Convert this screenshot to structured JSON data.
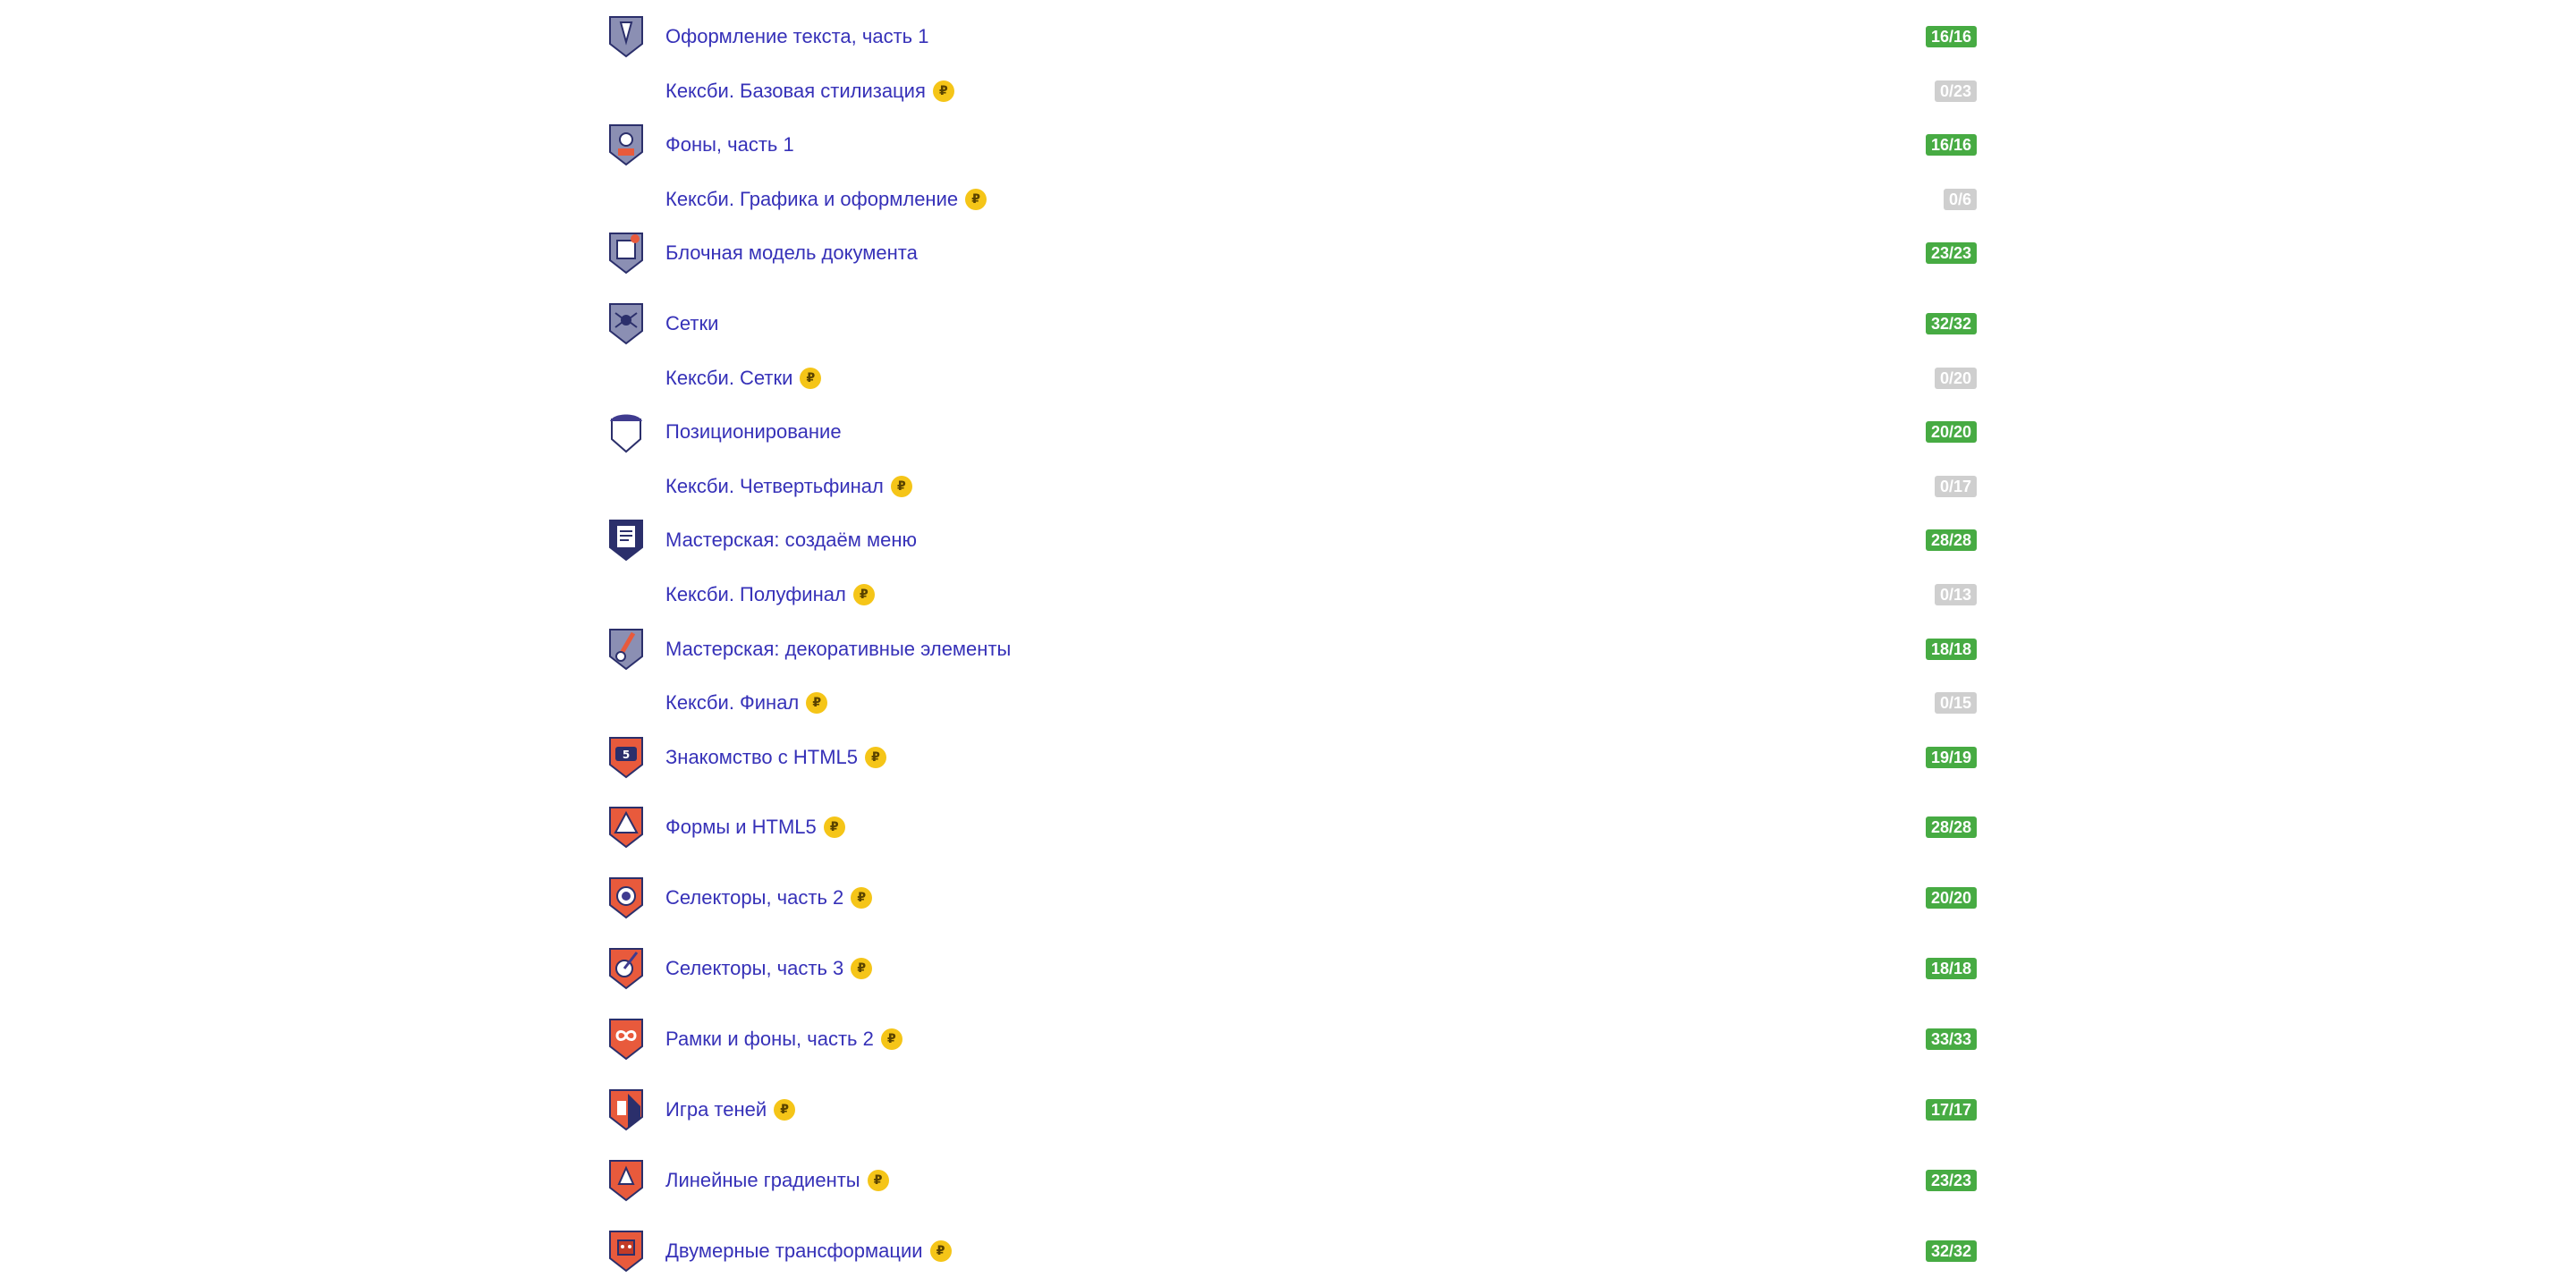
{
  "colors": {
    "link": "#3631b8",
    "done_badge": "#47ab43",
    "none_badge": "#cfcfcf",
    "coin": "#f5c518"
  },
  "courses": [
    {
      "title": "Оформление текста, часть 1",
      "progress": "16/16",
      "status": "done",
      "icon": "pen-shield-icon",
      "paid": false
    },
    {
      "title": "Кексби. Базовая стилизация",
      "progress": "0/23",
      "status": "none",
      "icon": "",
      "paid": true
    },
    {
      "title": "Фоны, часть 1",
      "progress": "16/16",
      "status": "done",
      "icon": "paint-shield-icon",
      "paid": false
    },
    {
      "title": "Кексби. Графика и оформление",
      "progress": "0/6",
      "status": "none",
      "icon": "",
      "paid": true
    },
    {
      "title": "Блочная модель документа",
      "progress": "23/23",
      "status": "done",
      "icon": "box-shield-icon",
      "paid": false
    },
    {
      "title": "Сетки",
      "progress": "32/32",
      "status": "done",
      "icon": "spider-shield-icon",
      "paid": false
    },
    {
      "title": "Кексби. Сетки",
      "progress": "0/20",
      "status": "none",
      "icon": "",
      "paid": true
    },
    {
      "title": "Позиционирование",
      "progress": "20/20",
      "status": "done",
      "icon": "hat-shield-icon",
      "paid": false
    },
    {
      "title": "Кексби. Четвертьфинал",
      "progress": "0/17",
      "status": "none",
      "icon": "",
      "paid": true
    },
    {
      "title": "Мастерская: создаём меню",
      "progress": "28/28",
      "status": "done",
      "icon": "document-shield-icon",
      "paid": false
    },
    {
      "title": "Кексби. Полуфинал",
      "progress": "0/13",
      "status": "none",
      "icon": "",
      "paid": true
    },
    {
      "title": "Мастерская: декоративные элементы",
      "progress": "18/18",
      "status": "done",
      "icon": "brush-shield-icon",
      "paid": false
    },
    {
      "title": "Кексби. Финал",
      "progress": "0/15",
      "status": "none",
      "icon": "",
      "paid": true
    },
    {
      "title": "Знакомство с HTML5",
      "progress": "19/19",
      "status": "done",
      "icon": "html5-shield-icon",
      "paid": true
    },
    {
      "title": "Формы и HTML5",
      "progress": "28/28",
      "status": "done",
      "icon": "triangle-shield-icon",
      "paid": true
    },
    {
      "title": "Селекторы, часть 2",
      "progress": "20/20",
      "status": "done",
      "icon": "target-shield-icon",
      "paid": true
    },
    {
      "title": "Селекторы, часть 3",
      "progress": "18/18",
      "status": "done",
      "icon": "target-arrows-shield-icon",
      "paid": true
    },
    {
      "title": "Рамки и фоны, часть 2",
      "progress": "33/33",
      "status": "done",
      "icon": "infinity-shield-icon",
      "paid": true
    },
    {
      "title": "Игра теней",
      "progress": "17/17",
      "status": "done",
      "icon": "shadow-hand-shield-icon",
      "paid": true
    },
    {
      "title": "Линейные градиенты",
      "progress": "23/23",
      "status": "done",
      "icon": "gradient-shield-icon",
      "paid": true
    },
    {
      "title": "Двумерные трансформации",
      "progress": "32/32",
      "status": "done",
      "icon": "robot-shield-icon",
      "paid": true
    }
  ],
  "coin_symbol": "₽"
}
